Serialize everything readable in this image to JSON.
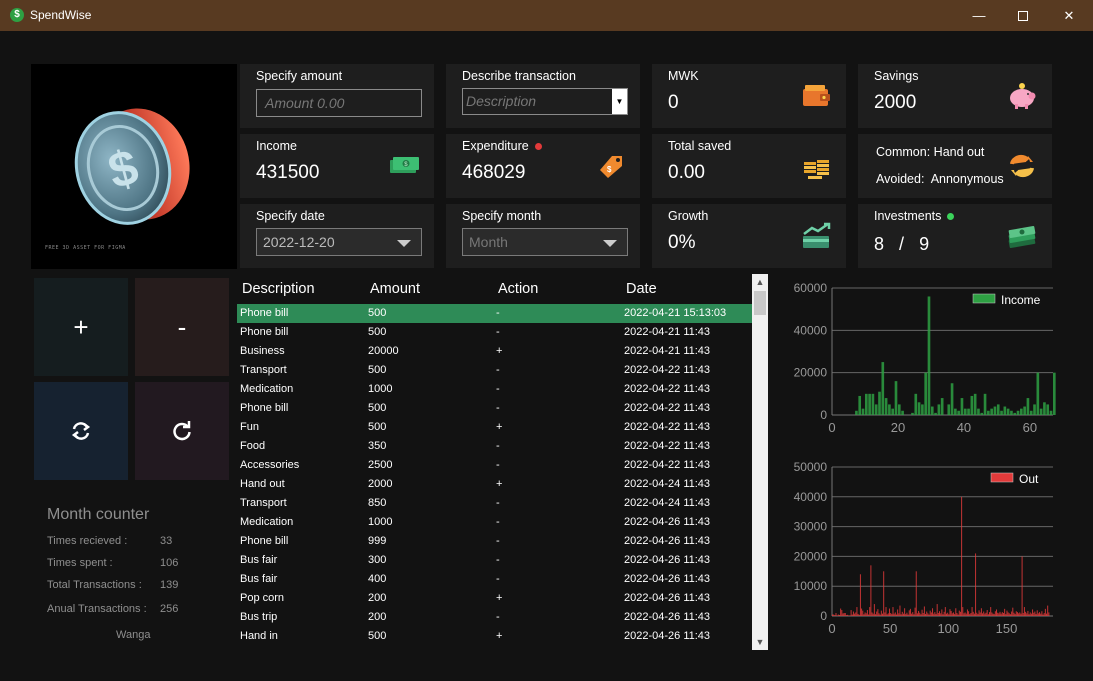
{
  "window": {
    "title": "SpendWise",
    "minimize": "—",
    "close": "✕"
  },
  "hero": {
    "asset_label": "FREE 3D ASSET FOR FIGMA"
  },
  "cards": {
    "amount": {
      "label": "Specify amount",
      "placeholder": "Amount 0.00"
    },
    "description": {
      "label": "Describe transaction",
      "placeholder": "Description"
    },
    "mwk": {
      "label": "MWK",
      "value": "0",
      "icon": "wallet-icon"
    },
    "savings": {
      "label": "Savings",
      "value": "2000",
      "icon": "piggy-bank-icon"
    },
    "income": {
      "label": "Income",
      "value": "431500",
      "icon": "cash-icon"
    },
    "expenditure": {
      "label": "Expenditure",
      "value": "468029",
      "icon": "price-tag-icon"
    },
    "total_saved": {
      "label": "Total saved",
      "value": "0.00",
      "icon": "coins-stack-icon"
    },
    "common": {
      "common_label": "Common:",
      "common_value": "Hand out",
      "avoided_label": "Avoided:",
      "avoided_value": "Annonymous",
      "icon": "exchange-icon"
    },
    "date": {
      "label": "Specify date",
      "value": "2022-12-20"
    },
    "month": {
      "label": "Specify month",
      "placeholder": "Month"
    },
    "growth": {
      "label": "Growth",
      "value": "0%",
      "icon": "growth-chart-icon"
    },
    "investments": {
      "label": "Investments",
      "value_a": "8",
      "separator": "/",
      "value_b": "9",
      "icon": "money-stack-icon"
    }
  },
  "actions": {
    "add": "+",
    "subtract": "-",
    "sync": "sync-icon",
    "refresh": "refresh-icon"
  },
  "month_counter": {
    "title": "Month counter",
    "rows": [
      {
        "label": "Times recieved :",
        "value": "33"
      },
      {
        "label": "Times spent :",
        "value": "106"
      },
      {
        "label": "Total Transactions :",
        "value": "139"
      },
      {
        "label": "Anual Transactions :",
        "value": "256"
      }
    ],
    "name": "Wanga"
  },
  "table": {
    "headers": [
      "Description",
      "Amount",
      "Action",
      "Date"
    ],
    "rows": [
      [
        "Phone bill",
        "500",
        "-",
        "2022-04-21 15:13:03"
      ],
      [
        "Phone bill",
        "500",
        "-",
        "2022-04-21 11:43"
      ],
      [
        "Business",
        "20000",
        "+",
        "2022-04-21 11:43"
      ],
      [
        "Transport",
        "500",
        "-",
        "2022-04-22 11:43"
      ],
      [
        "Medication",
        "1000",
        "-",
        "2022-04-22 11:43"
      ],
      [
        "Phone bill",
        "500",
        "-",
        "2022-04-22 11:43"
      ],
      [
        "Fun",
        "500",
        "+",
        "2022-04-22 11:43"
      ],
      [
        "Food",
        "350",
        "-",
        "2022-04-22 11:43"
      ],
      [
        "Accessories",
        "2500",
        "-",
        "2022-04-22 11:43"
      ],
      [
        "Hand out",
        "2000",
        "+",
        "2022-04-24 11:43"
      ],
      [
        "Transport",
        "850",
        "-",
        "2022-04-24 11:43"
      ],
      [
        "Medication",
        "1000",
        "-",
        "2022-04-26 11:43"
      ],
      [
        "Phone bill",
        "999",
        "-",
        "2022-04-26 11:43"
      ],
      [
        "Bus fair",
        "300",
        "-",
        "2022-04-26 11:43"
      ],
      [
        "Bus fair",
        "400",
        "-",
        "2022-04-26 11:43"
      ],
      [
        "Pop corn",
        "200",
        "+",
        "2022-04-26 11:43"
      ],
      [
        "Bus trip",
        "200",
        "-",
        "2022-04-26 11:43"
      ],
      [
        "Hand in",
        "500",
        "+",
        "2022-04-26 11:43"
      ]
    ],
    "selected_index": 0
  },
  "chart_data": [
    {
      "type": "bar",
      "legend": "Income",
      "color": "#2ea043",
      "ylim": [
        0,
        60000
      ],
      "yticks": [
        "0",
        "20000",
        "40000",
        "60000"
      ],
      "xticks": [
        "0",
        "20",
        "40",
        "60"
      ],
      "xlim": [
        0,
        67
      ],
      "values": [
        0,
        0,
        0,
        0,
        0,
        0,
        0,
        2000,
        9000,
        3000,
        10000,
        10000,
        10000,
        5000,
        11000,
        25000,
        8000,
        5000,
        3000,
        16000,
        5000,
        2000,
        0,
        0,
        1000,
        10000,
        6000,
        5000,
        20000,
        56000,
        4000,
        1000,
        5000,
        8000,
        0,
        5000,
        15000,
        3000,
        2000,
        8000,
        3000,
        3000,
        9000,
        10000,
        3000,
        1000,
        10000,
        2000,
        3000,
        4000,
        5000,
        2000,
        4000,
        3000,
        2000,
        1000,
        2000,
        3000,
        4000,
        8000,
        2000,
        5000,
        20000,
        3000,
        6000,
        5000,
        2000,
        20000
      ]
    },
    {
      "type": "bar",
      "legend": "Out",
      "color": "#e23a3a",
      "ylim": [
        0,
        50000
      ],
      "yticks": [
        "0",
        "10000",
        "20000",
        "30000",
        "40000",
        "50000"
      ],
      "xticks": [
        "0",
        "50",
        "100",
        "150"
      ],
      "xlim": [
        0,
        190
      ],
      "values": [
        500,
        500,
        300,
        1000,
        200,
        500,
        350,
        2500,
        2000,
        850,
        1000,
        999,
        300,
        400,
        200,
        200,
        2000,
        500,
        1500,
        800,
        1200,
        3000,
        700,
        400,
        14000,
        2500,
        1800,
        600,
        1200,
        900,
        2000,
        500,
        3000,
        17000,
        1200,
        800,
        4000,
        600,
        1500,
        2300,
        900,
        500,
        1800,
        800,
        15000,
        1200,
        3000,
        600,
        900,
        2500,
        1000,
        700,
        3000,
        800,
        1200,
        500,
        2200,
        900,
        3500,
        600,
        1400,
        800,
        2600,
        700,
        1100,
        500,
        1900,
        2400,
        800,
        1300,
        600,
        2800,
        15000,
        900,
        1700,
        1100,
        600,
        2100,
        1000,
        3200,
        700,
        1500,
        900,
        500,
        1800,
        1200,
        2600,
        800,
        1300,
        700,
        4000,
        1000,
        1600,
        900,
        2200,
        600,
        1400,
        3000,
        800,
        1100,
        600,
        2300,
        1700,
        900,
        1200,
        700,
        2600,
        1000,
        500,
        1800,
        1400,
        40000,
        3000,
        900,
        1200,
        800,
        2200,
        1600,
        700,
        1000,
        3000,
        1400,
        800,
        21000,
        1100,
        700,
        1900,
        1200,
        2600,
        900,
        1500,
        800,
        1100,
        2000,
        600,
        1300,
        3000,
        1200,
        800,
        700,
        1600,
        2200,
        1100,
        900,
        1400,
        800,
        1300,
        1000,
        2400,
        700,
        1800,
        1200,
        900,
        600,
        1500,
        2800,
        1100,
        700,
        1600,
        1300,
        900,
        1200,
        800,
        20000,
        1000,
        3000,
        1400,
        900,
        1700,
        600,
        1200,
        800,
        2200,
        1100,
        1500,
        700,
        1900,
        900,
        1300,
        800,
        1600,
        500,
        1000,
        2400,
        800,
        3500,
        1200
      ]
    }
  ]
}
